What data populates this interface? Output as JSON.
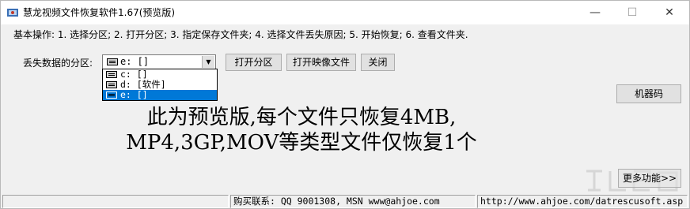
{
  "window": {
    "title": "慧龙视频文件恢复软件1.67(预览版)",
    "controls": {
      "minimize": "—",
      "maximize": "☐",
      "close": "✕"
    }
  },
  "steps_text": "基本操作: 1. 选择分区; 2. 打开分区; 3. 指定保存文件夹; 4. 选择文件丢失原因; 5. 开始恢复; 6. 查看文件夹.",
  "drive": {
    "label": "丢失数据的分区:",
    "selected": "e:  []",
    "options": [
      "c:  []",
      "d:  [软件]",
      "e:  []"
    ],
    "selected_index": 2
  },
  "buttons": {
    "open_partition": "打开分区",
    "open_image": "打开映像文件",
    "close": "关闭",
    "machine_code": "机器码",
    "more": "更多功能>>"
  },
  "notice": {
    "line1": "此为预览版,每个文件只恢复4MB,",
    "line2": "MP4,3GP,MOV等类型文件仅恢复1个"
  },
  "statusbar": {
    "contact": "购买联系: QQ 9001308, MSN www@ahjoe.com",
    "url": "http://www.ahjoe.com/datrescusoft.asp"
  },
  "colors": {
    "selection": "#0078d7",
    "face": "#f0f0f0",
    "titlebar": "#ffffff"
  }
}
